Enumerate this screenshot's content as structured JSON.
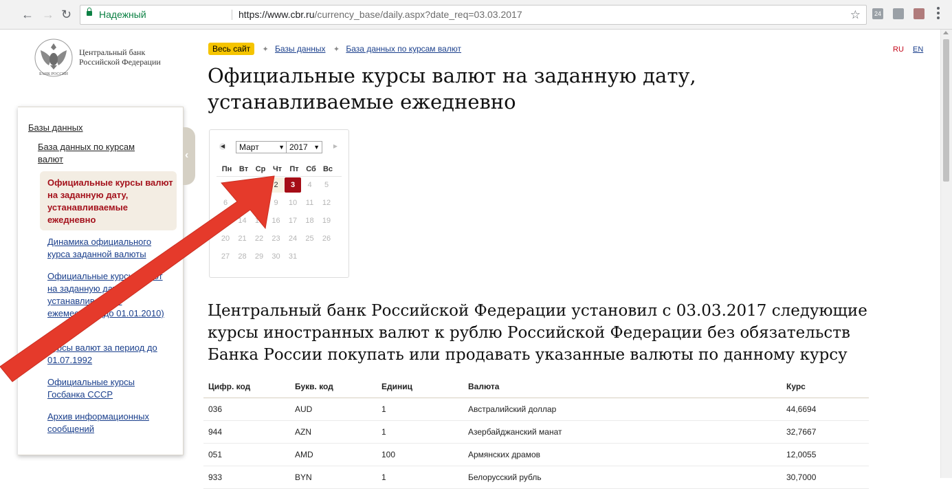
{
  "browser": {
    "secure_label": "Надежный",
    "url_main": "https://www.cbr.ru",
    "url_rest": "/currency_base/daily.aspx?date_req=03.03.2017",
    "ext_badge": "24"
  },
  "header": {
    "logo_line1": "Центральный банк",
    "logo_line2": "Российской Федерации",
    "logo_seal_text": "БАНК РОССИИ",
    "breadcrumbs": [
      "Весь сайт",
      "Базы данных",
      "База данных по курсам валют"
    ],
    "lang_ru": "RU",
    "lang_en": "EN"
  },
  "page_title": "Официальные курсы валют на заданную дату, устанавливаемые ежедневно",
  "sidebar": {
    "root": "Базы данных",
    "parent": "База данных по курсам валют",
    "active": "Официальные курсы валют на заданную дату, устанавливаемые ежедневно",
    "items": [
      "Динамика официального курса заданной валюты",
      "Официальные курсы валют на заданную дату, устанавливаемые ежемесячно (до 01.01.2010)",
      "Курсы валют за период до 01.07.1992",
      "Официальные курсы Госбанка СССР",
      "Архив информационных сообщений"
    ]
  },
  "calendar": {
    "month": "Март",
    "year": "2017",
    "weekdays": [
      "Пн",
      "Вт",
      "Ср",
      "Чт",
      "Пт",
      "Сб",
      "Вс"
    ],
    "weeks": [
      [
        "",
        "",
        "1",
        "2",
        "3",
        "4",
        "5"
      ],
      [
        "6",
        "7",
        "8",
        "9",
        "10",
        "11",
        "12"
      ],
      [
        "13",
        "14",
        "15",
        "16",
        "17",
        "18",
        "19"
      ],
      [
        "20",
        "21",
        "22",
        "23",
        "24",
        "25",
        "26"
      ],
      [
        "27",
        "28",
        "29",
        "30",
        "31",
        "",
        ""
      ]
    ],
    "selected_day": "3",
    "highlighted_day": "2",
    "available_days": [
      "1",
      "2",
      "3"
    ],
    "selected_color": "#a50d16"
  },
  "result_title": "Центральный банк Российской Федерации установил с 03.03.2017 следующие курсы иностранных валют к рублю Российской Федерации без обязательств Банка России покупать или продавать указанные валюты по данному курсу",
  "rates": {
    "headers": [
      "Цифр. код",
      "Букв. код",
      "Единиц",
      "Валюта",
      "Курс"
    ],
    "rows": [
      [
        "036",
        "AUD",
        "1",
        "Австралийский доллар",
        "44,6694"
      ],
      [
        "944",
        "AZN",
        "1",
        "Азербайджанский манат",
        "32,7667"
      ],
      [
        "051",
        "AMD",
        "100",
        "Армянских драмов",
        "12,0055"
      ],
      [
        "933",
        "BYN",
        "1",
        "Белорусский рубль",
        "30,7000"
      ]
    ]
  },
  "colors": {
    "accent_yellow": "#f5c400",
    "active_red": "#a4121c",
    "link_blue": "#1a3f8c",
    "annotation_arrow": "#e53a2b"
  }
}
